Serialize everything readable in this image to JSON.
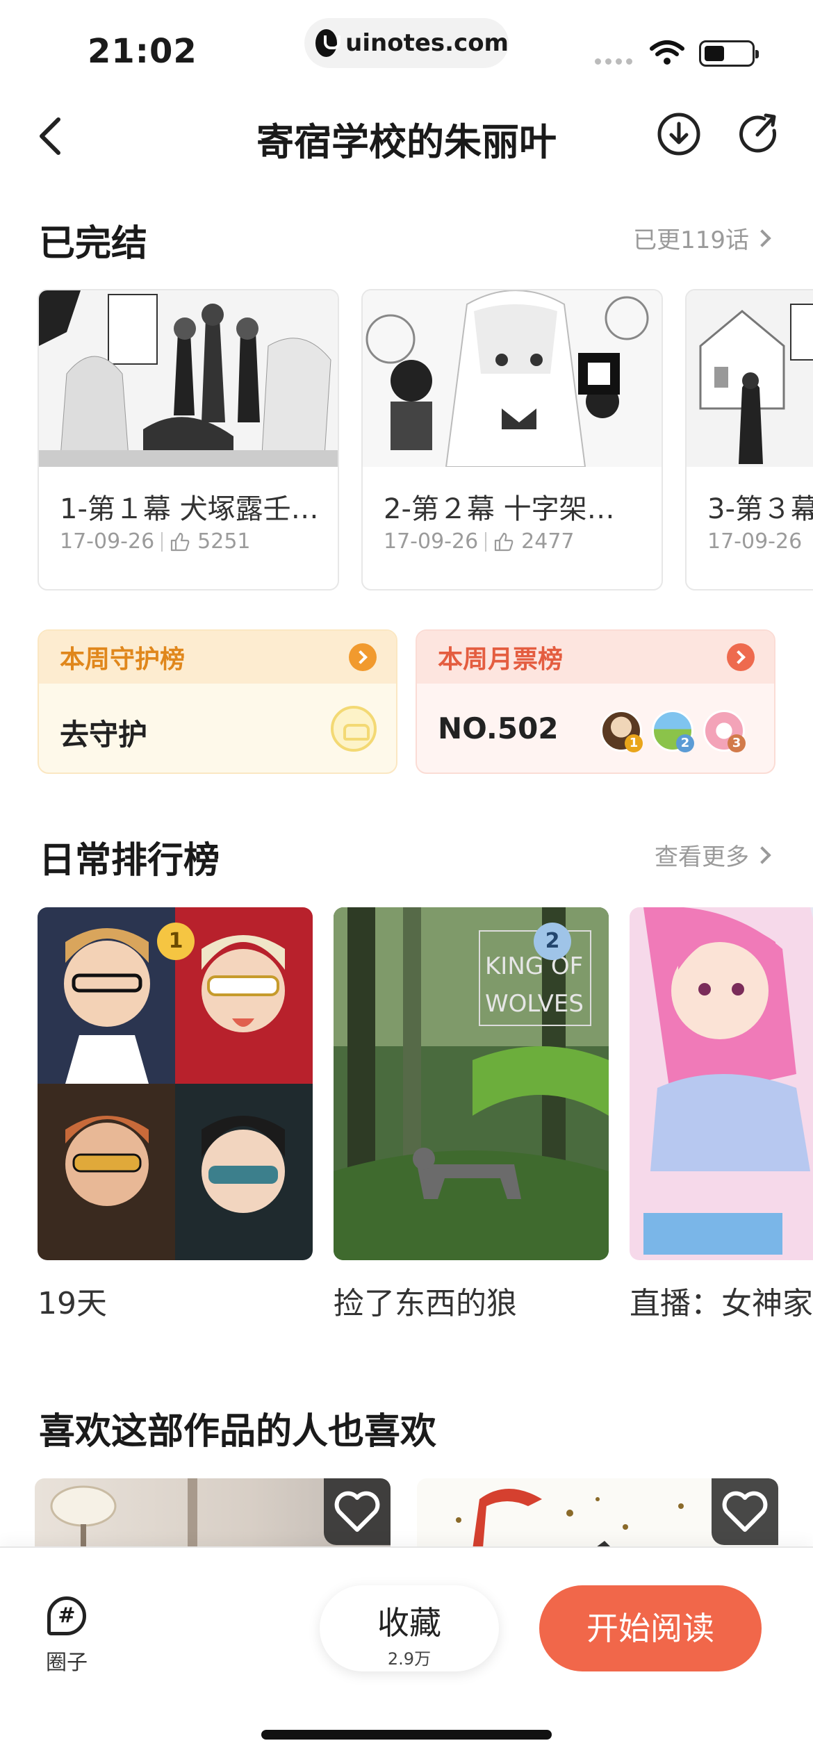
{
  "status_bar": {
    "time": "21:02",
    "url": "uinotes.com"
  },
  "nav": {
    "title": "寄宿学校的朱丽叶",
    "back_icon": "chevron-left-icon",
    "download_icon": "download-icon",
    "share_icon": "share-icon"
  },
  "chapters_section": {
    "title": "已完结",
    "more": "已更119话",
    "items": [
      {
        "name": "1-第１幕 犬塚露壬…",
        "date": "17-09-26",
        "likes": "5251"
      },
      {
        "name": "2-第２幕 十字架…",
        "date": "17-09-26",
        "likes": "2477"
      },
      {
        "name": "3-第３幕",
        "date": "17-09-26",
        "likes": ""
      }
    ]
  },
  "guard_rank": {
    "title": "本周守护榜",
    "action": "去守护"
  },
  "monthly_rank": {
    "title": "本周月票榜",
    "rank": "NO.502",
    "avatars": [
      "1",
      "2",
      "3"
    ]
  },
  "daily_section": {
    "title": "日常排行榜",
    "more": "查看更多",
    "items": [
      {
        "title": "19天",
        "medal": "1"
      },
      {
        "title": "捡了东西的狼",
        "medal": "2",
        "cover_text_1": "KING OF",
        "cover_text_2": "WOLVES"
      },
      {
        "title": "直播：女神家",
        "medal": ""
      }
    ]
  },
  "recommend_section": {
    "title": "喜欢这部作品的人也喜欢"
  },
  "bottom_bar": {
    "circle_label": "圈子",
    "collect_label": "收藏",
    "collect_count": "2.9万",
    "read_label": "开始阅读"
  },
  "colors": {
    "accent": "#f1674a",
    "guard_orange": "#f19a2e",
    "monthly_red": "#ee6a4e"
  }
}
